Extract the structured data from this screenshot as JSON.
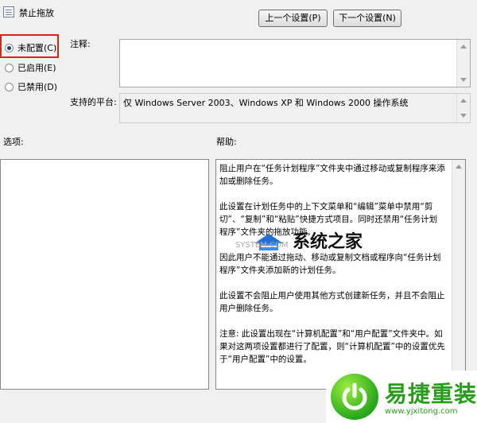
{
  "window": {
    "title": "禁止拖放"
  },
  "nav": {
    "prev_label": "上一个设置(P)",
    "next_label": "下一个设置(N)"
  },
  "state": {
    "options": [
      {
        "label": "未配置(C)",
        "checked": true
      },
      {
        "label": "已启用(E)",
        "checked": false
      },
      {
        "label": "已禁用(D)",
        "checked": false
      }
    ]
  },
  "comment": {
    "label": "注释:",
    "value": ""
  },
  "platform": {
    "label": "支持的平台:",
    "value": "仅 Windows Server 2003、Windows XP 和 Windows 2000 操作系统"
  },
  "options_panel": {
    "label": "选项:"
  },
  "help": {
    "label": "帮助:",
    "paragraphs": [
      "阻止用户在“任务计划程序”文件夹中通过移动或复制程序来添加或删除任务。",
      "此设置在计划任务中的上下文菜单和“编辑”菜单中禁用“剪切”、“复制”和“粘贴”快捷方式项目。同时还禁用“任务计划程序”文件夹的拖放功能。",
      "因此用户不能通过拖动、移动或复制文档或程序向“任务计划程序”文件夹添加新的计划任务。",
      "此设置不会阻止用户使用其他方式创建新任务，并且不会阻止用户删除任务。",
      "注意: 此设置出现在“计算机配置”和“用户配置”文件夹中。如果对这两项设置都进行了配置，则“计算机配置”中的设置优先于“用户配置”中的设置。"
    ]
  },
  "watermark": {
    "site_name": "系统之家",
    "url": "SYSTEM.COM"
  },
  "logo": {
    "name": "易捷重装",
    "url": "www.yjxitong.com"
  }
}
